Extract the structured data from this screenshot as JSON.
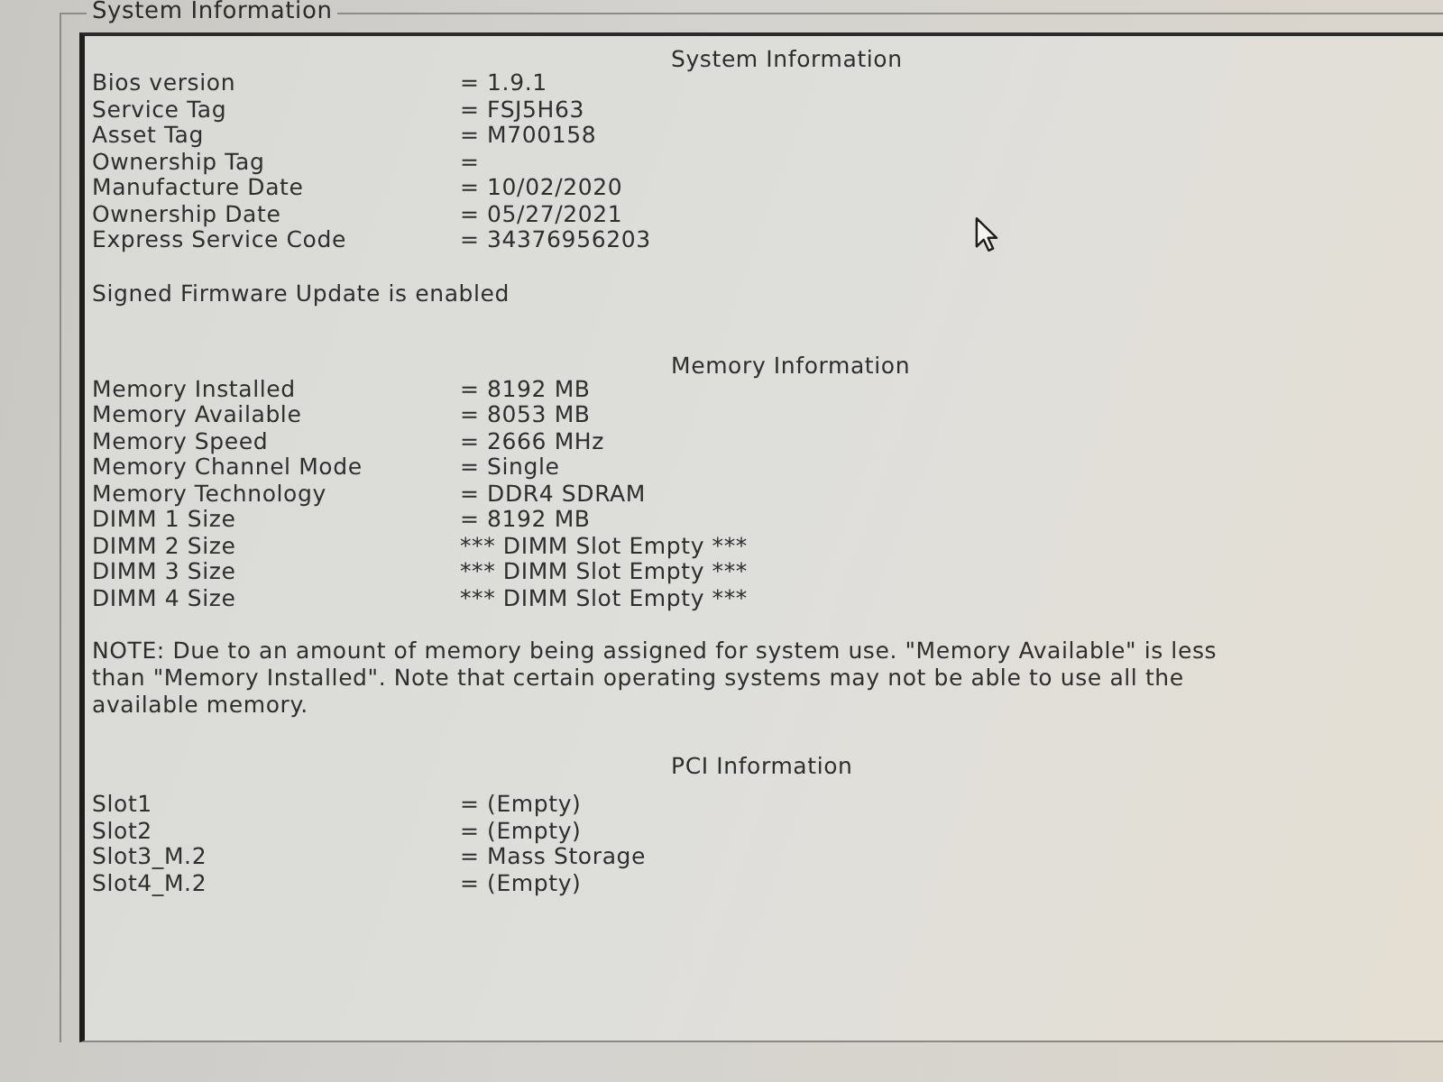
{
  "group_title": "System Information",
  "sections": [
    {
      "title": "System Information",
      "rows": [
        {
          "label": "Bios version",
          "value": "= 1.9.1"
        },
        {
          "label": "Service Tag",
          "value": "= FSJ5H63"
        },
        {
          "label": "Asset Tag",
          "value": "= M700158"
        },
        {
          "label": "Ownership Tag",
          "value": "="
        },
        {
          "label": "Manufacture Date",
          "value": "= 10/02/2020"
        },
        {
          "label": "Ownership Date",
          "value": "= 05/27/2021"
        },
        {
          "label": "Express Service Code",
          "value": "= 34376956203"
        }
      ],
      "notes": [
        "Signed Firmware Update is enabled"
      ]
    },
    {
      "title": "Memory Information",
      "rows": [
        {
          "label": "Memory Installed",
          "value": "= 8192 MB"
        },
        {
          "label": "Memory Available",
          "value": "= 8053 MB"
        },
        {
          "label": "Memory Speed",
          "value": "= 2666 MHz"
        },
        {
          "label": "Memory Channel Mode",
          "value": "= Single"
        },
        {
          "label": "Memory Technology",
          "value": "= DDR4 SDRAM"
        },
        {
          "label": "DIMM 1 Size",
          "value": "= 8192 MB"
        },
        {
          "label": "DIMM 2 Size",
          "value": "*** DIMM Slot Empty ***"
        },
        {
          "label": "DIMM 3 Size",
          "value": "*** DIMM Slot Empty ***"
        },
        {
          "label": "DIMM 4 Size",
          "value": "*** DIMM Slot Empty ***"
        }
      ],
      "notes": [
        "NOTE: Due to an amount of memory being assigned for system use. \"Memory Available\" is less than \"Memory Installed\". Note that certain operating systems may not be able to use all the available memory."
      ]
    },
    {
      "title": "PCI Information",
      "rows": [
        {
          "label": "Slot1",
          "value": "= (Empty)"
        },
        {
          "label": "Slot2",
          "value": "= (Empty)"
        },
        {
          "label": "Slot3_M.2",
          "value": "= Mass Storage"
        },
        {
          "label": "Slot4_M.2",
          "value": "= (Empty)"
        }
      ]
    }
  ]
}
